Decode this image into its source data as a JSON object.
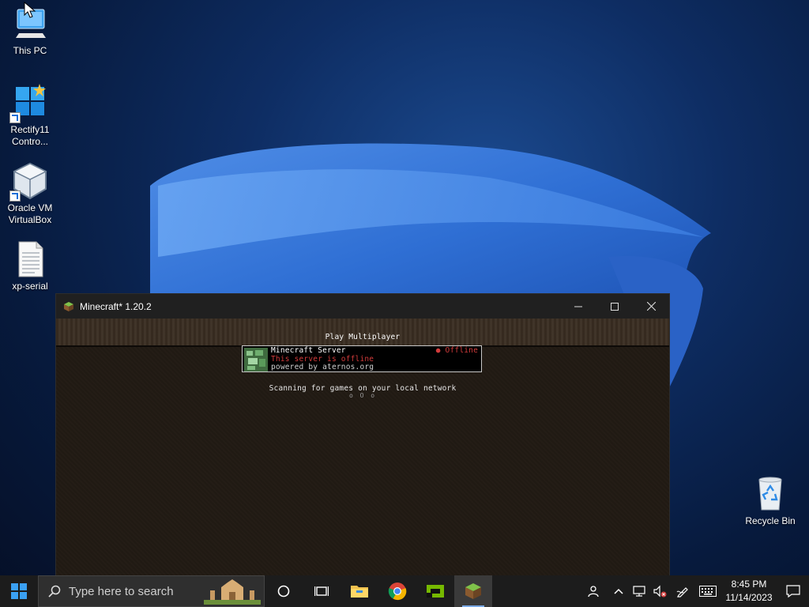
{
  "desktop": {
    "icons": [
      {
        "label": "This PC"
      },
      {
        "label": "Rectify11 Contro..."
      },
      {
        "label": "Oracle VM VirtualBox"
      },
      {
        "label": "xp-serial"
      },
      {
        "label": "Recycle Bin"
      }
    ]
  },
  "window": {
    "title": "Minecraft* 1.20.2",
    "screen_heading": "Play Multiplayer",
    "server": {
      "name": "Minecraft Server",
      "status": "● Offline",
      "motd_line1": "This server is offline",
      "motd_line2": "powered by aternos.org"
    },
    "lan_scan_text": "Scanning for games on your local network",
    "lan_scan_dots": "o O o"
  },
  "taskbar": {
    "search_placeholder": "Type here to search",
    "apps": [
      "start-button",
      "cortana",
      "task-view",
      "file-explorer",
      "google-chrome",
      "nvidia-app",
      "minecraft-launcher"
    ],
    "time": "8:45 PM",
    "date": "11/14/2023"
  },
  "colors": {
    "accent": "#7aa9e6",
    "offline_red": "#d23b3b",
    "taskbar_bg": "#1c1c1c"
  }
}
